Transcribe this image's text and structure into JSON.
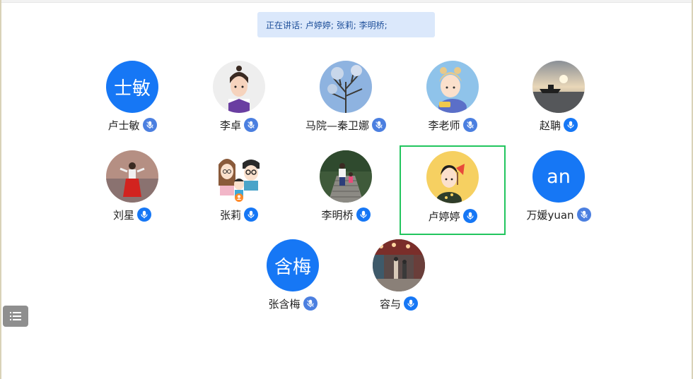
{
  "speaking_banner": {
    "label": "正在讲话: 卢婷婷; 张莉; 李明桥;"
  },
  "participants": [
    {
      "name": "卢士敏",
      "avatar_text": "士敏",
      "avatar_kind": "initials",
      "mic_state": "muted"
    },
    {
      "name": "李卓",
      "avatar_kind": "photo",
      "avatar_icon": "cartoon-man-avatar",
      "mic_state": "muted"
    },
    {
      "name": "马院—秦卫娜",
      "avatar_kind": "photo",
      "avatar_icon": "tree-sky-photo",
      "mic_state": "muted"
    },
    {
      "name": "李老师",
      "avatar_kind": "photo",
      "avatar_icon": "cartoon-girl-avatar",
      "mic_state": "muted"
    },
    {
      "name": "赵聃",
      "avatar_kind": "photo",
      "avatar_icon": "sunset-boat-photo",
      "mic_state": "on"
    },
    {
      "name": "刘星",
      "avatar_kind": "photo",
      "avatar_icon": "person-red-skirt-photo",
      "mic_state": "on"
    },
    {
      "name": "张莉",
      "avatar_kind": "photo",
      "avatar_icon": "cartoon-family-avatar",
      "mic_state": "on",
      "speaking": true
    },
    {
      "name": "李明桥",
      "avatar_kind": "photo",
      "avatar_icon": "stairs-park-photo",
      "mic_state": "on",
      "speaking": true
    },
    {
      "name": "卢婷婷",
      "avatar_kind": "photo",
      "avatar_icon": "cartoon-fan-avatar",
      "mic_state": "on",
      "speaking": true,
      "active": true
    },
    {
      "name": "万媛yuan",
      "avatar_text": "an",
      "avatar_kind": "initials",
      "mic_state": "muted"
    },
    {
      "name": "张含梅",
      "avatar_text": "含梅",
      "avatar_kind": "initials",
      "mic_state": "muted"
    },
    {
      "name": "容与",
      "avatar_kind": "photo",
      "avatar_icon": "market-street-photo",
      "mic_state": "on"
    }
  ],
  "colors": {
    "accent": "#1677f5",
    "active_border": "#22c55e",
    "banner_bg": "#dbe8fb",
    "banner_text": "#1e4f9a"
  },
  "toolbar": {
    "list_toggle_icon": "list-icon"
  }
}
